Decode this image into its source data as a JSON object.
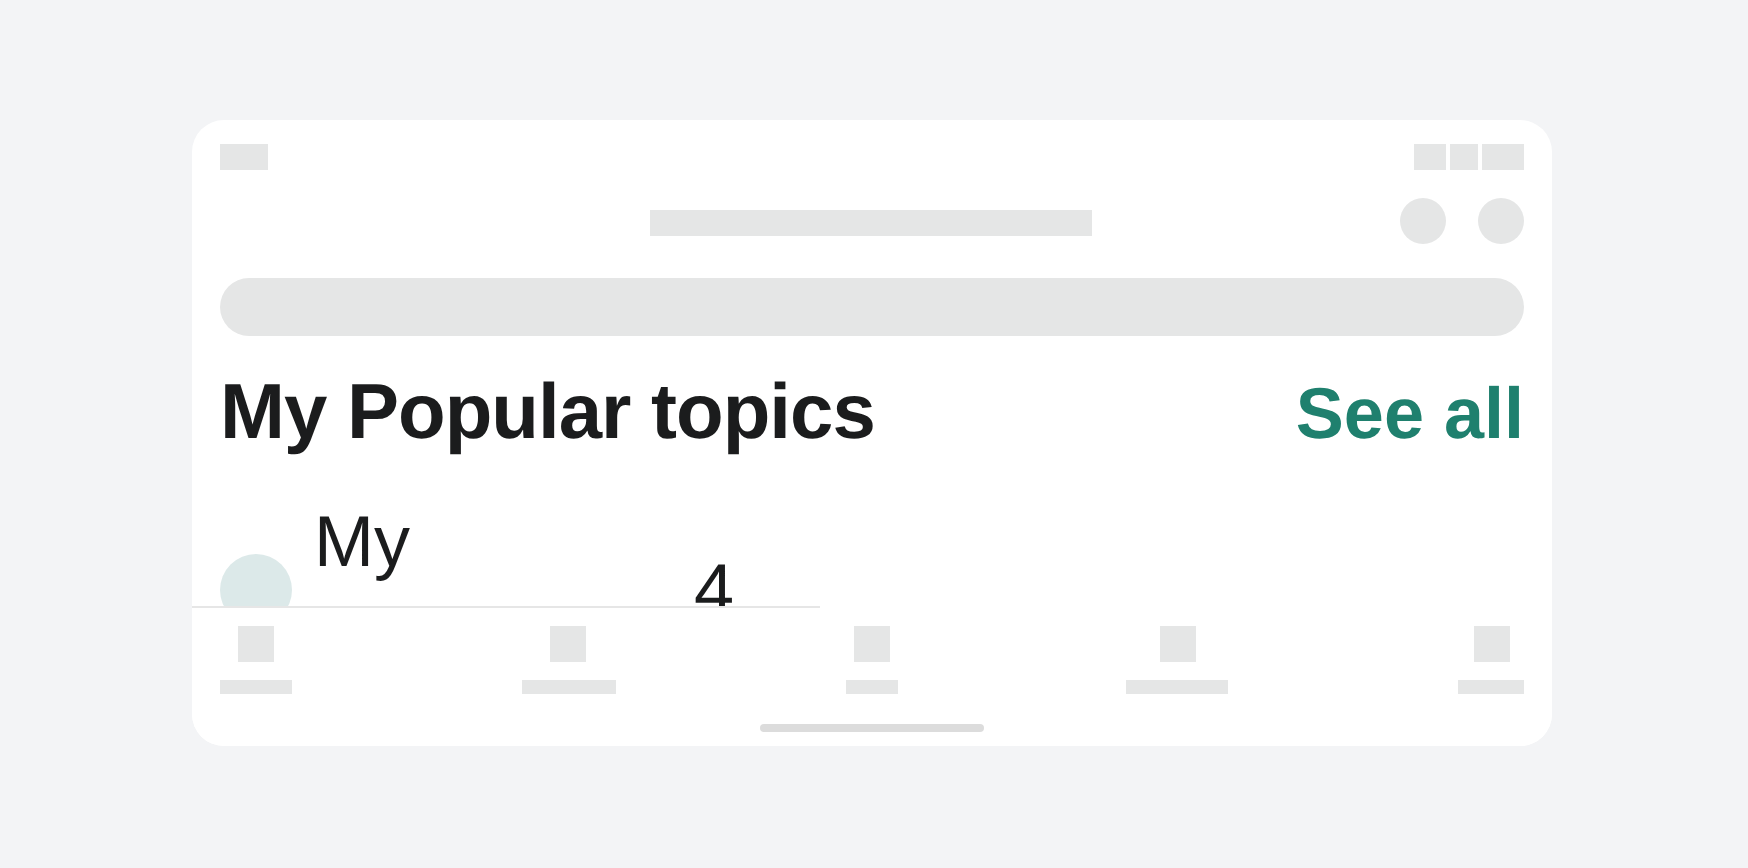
{
  "section": {
    "title": "My Popular topics",
    "link": "See all"
  },
  "topics": [
    {
      "title": "My",
      "count": "4"
    }
  ],
  "tab_bar": {
    "tabs": [
      {
        "selected": false
      },
      {
        "selected": false
      },
      {
        "selected": false
      },
      {
        "selected": false
      },
      {
        "selected": false
      }
    ]
  }
}
